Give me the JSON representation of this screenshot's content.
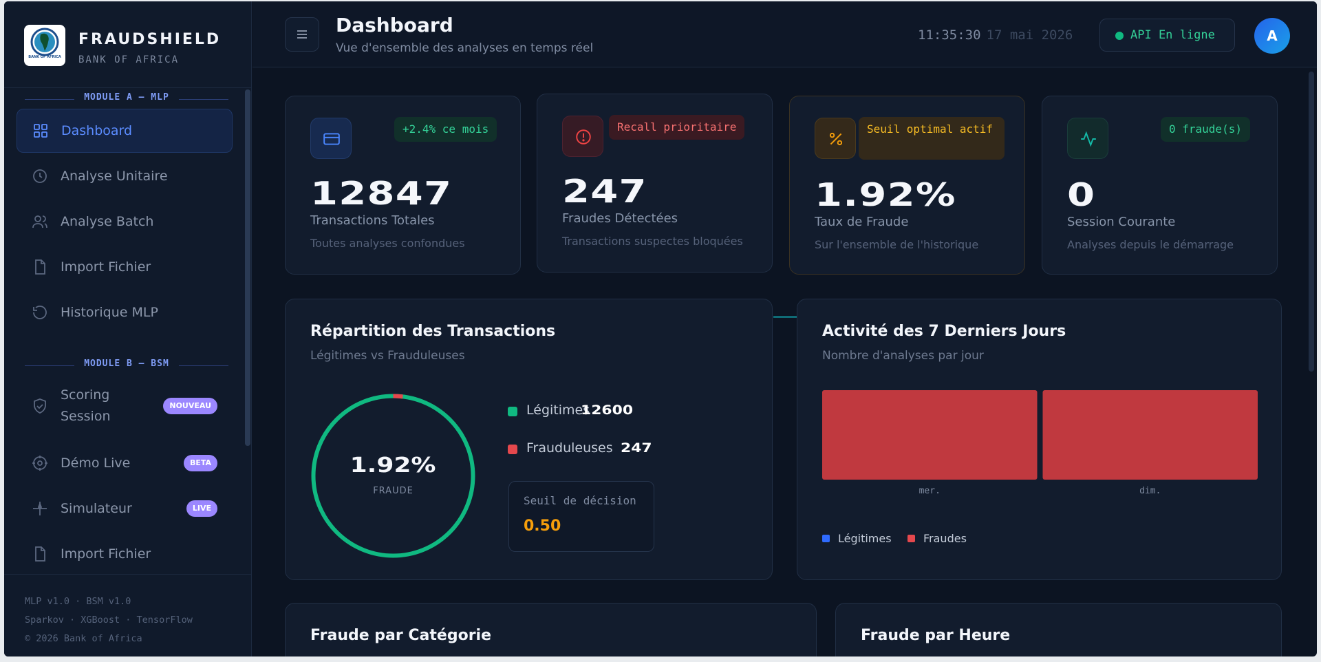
{
  "brand": {
    "name": "FRAUDSHIELD",
    "subtitle": "BANK OF AFRICA",
    "logo_caption": "BANK OF AFRICA"
  },
  "sidebar": {
    "section_a": "MODULE A — MLP",
    "section_b": "MODULE B — BSM",
    "items": [
      {
        "label": "Dashboard",
        "icon": "grid-icon",
        "active": true
      },
      {
        "label": "Analyse Unitaire",
        "icon": "clock-icon"
      },
      {
        "label": "Analyse Batch",
        "icon": "users-icon"
      },
      {
        "label": "Import Fichier",
        "icon": "file-icon"
      },
      {
        "label": "Historique MLP",
        "icon": "history-icon"
      },
      {
        "label": "Scoring Session",
        "icon": "shield-icon",
        "badge": "NOUVEAU"
      },
      {
        "label": "Démo Live",
        "icon": "target-icon",
        "badge": "BETA"
      },
      {
        "label": "Simulateur",
        "icon": "sparkle-icon",
        "badge": "LIVE"
      },
      {
        "label": "Import Fichier",
        "icon": "file-icon"
      }
    ],
    "footer": [
      "MLP v1.0 · BSM v1.0",
      "Sparkov · XGBoost · TensorFlow",
      "© 2026 Bank of Africa"
    ]
  },
  "header": {
    "title": "Dashboard",
    "subtitle": "Vue d'ensemble des analyses en temps réel",
    "time": "11:35:30",
    "date": "17 mai 2026",
    "api_status": "API En ligne",
    "avatar_initial": "A"
  },
  "stats": [
    {
      "value": "12847",
      "label": "Transactions Totales",
      "desc": "Toutes analyses confondues",
      "badge": "+2.4% ce mois",
      "icon": "card-icon"
    },
    {
      "value": "247",
      "label": "Fraudes Détectées",
      "desc": "Transactions suspectes bloquées",
      "badge": "Recall prioritaire",
      "icon": "alert-icon"
    },
    {
      "value": "1.92%",
      "label": "Taux de Fraude",
      "desc": "Sur l'ensemble de l'historique",
      "badge": "Seuil optimal actif",
      "icon": "percent-icon"
    },
    {
      "value": "0",
      "label": "Session Courante",
      "desc": "Analyses depuis le démarrage",
      "badge": "0 fraude(s)",
      "icon": "pulse-icon"
    }
  ],
  "repartition": {
    "title": "Répartition des Transactions",
    "subtitle": "Légitimes vs Frauduleuses",
    "center_value": "1.92%",
    "center_label": "FRAUDE",
    "fraud_fraction": 0.0192,
    "legit_label": "Légitimes",
    "legit_value": "12600",
    "fraud_label": "Frauduleuses",
    "fraud_value": "247",
    "threshold_label": "Seuil de décision",
    "threshold_value": "0.50"
  },
  "activity": {
    "title": "Activité des 7 Derniers Jours",
    "subtitle": "Nombre d'analyses par jour",
    "legend_legit": "Légitimes",
    "legend_fraud": "Fraudes"
  },
  "chart_data": {
    "type": "bar",
    "categories": [
      "mer.",
      "dim."
    ],
    "series": [
      {
        "name": "Légitimes",
        "values": [
          0,
          0
        ]
      },
      {
        "name": "Fraudes",
        "values": [
          1,
          1
        ]
      }
    ],
    "xlabel": "",
    "ylabel": ""
  },
  "bottom": {
    "categorie_title": "Fraude par Catégorie",
    "heure_title": "Fraude par Heure"
  },
  "colors": {
    "accent": "#5b8cff",
    "legit": "#10b981",
    "fraud": "#e5484d",
    "warn": "#f59e0b",
    "badge": "#9b87ff"
  }
}
